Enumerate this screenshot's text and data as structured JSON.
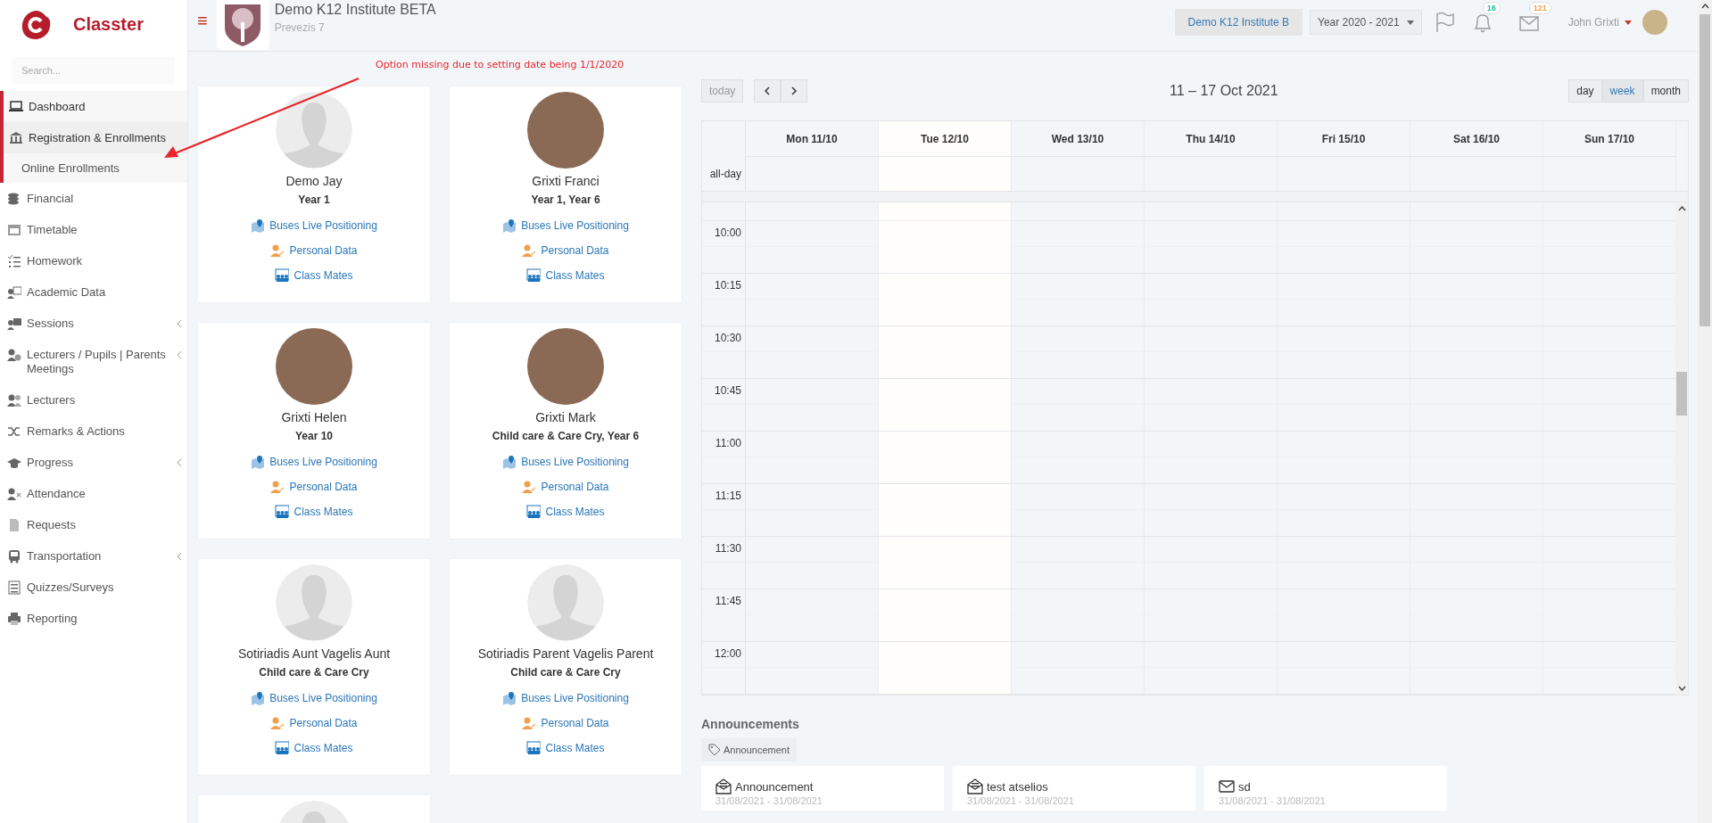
{
  "brand": {
    "name": "Classter"
  },
  "sidebar": {
    "search": {
      "placeholder": "Search..."
    },
    "items": [
      {
        "label": "Dashboard",
        "selected": true,
        "expanded": false,
        "has_submenu": false
      },
      {
        "label": "Registration & Enrollments",
        "selected": false,
        "expanded": true,
        "has_submenu": false,
        "children": [
          {
            "label": "Online Enrollments",
            "selected": false
          }
        ]
      },
      {
        "label": "Financial",
        "selected": false,
        "expanded": false,
        "has_submenu": false
      },
      {
        "label": "Timetable",
        "selected": false,
        "expanded": false,
        "has_submenu": false
      },
      {
        "label": "Homework",
        "selected": false,
        "expanded": false,
        "has_submenu": false
      },
      {
        "label": "Academic Data",
        "selected": false,
        "expanded": false,
        "has_submenu": false
      },
      {
        "label": "Sessions",
        "selected": false,
        "expanded": false,
        "has_submenu": true
      },
      {
        "label": "Lecturers / Pupils | Parents Meetings",
        "selected": false,
        "expanded": false,
        "has_submenu": true
      },
      {
        "label": "Lecturers",
        "selected": false,
        "expanded": false,
        "has_submenu": false
      },
      {
        "label": "Remarks & Actions",
        "selected": false,
        "expanded": false,
        "has_submenu": false
      },
      {
        "label": "Progress",
        "selected": false,
        "expanded": false,
        "has_submenu": true
      },
      {
        "label": "Attendance",
        "selected": false,
        "expanded": false,
        "has_submenu": false
      },
      {
        "label": "Requests",
        "selected": false,
        "expanded": false,
        "has_submenu": false
      },
      {
        "label": "Transportation",
        "selected": false,
        "expanded": false,
        "has_submenu": true
      },
      {
        "label": "Quizzes/Surveys",
        "selected": false,
        "expanded": false,
        "has_submenu": false
      },
      {
        "label": "Reporting",
        "selected": false,
        "expanded": false,
        "has_submenu": false
      }
    ]
  },
  "header": {
    "menu_glyph": "≡",
    "institute": "Demo K12 Institute BETA",
    "address": "Prevezis 7",
    "institute_button": "Demo K12 Institute B",
    "year_select": "Year 2020 - 2021",
    "badges": [
      {
        "count": "16",
        "color": "#1abc9c"
      },
      {
        "count": "121",
        "color": "#f0a04b"
      }
    ],
    "user": "John Grixti"
  },
  "annotation": {
    "text": "Option missing due to setting date being  1/1/2020"
  },
  "cards": [
    {
      "kind": "silhouette",
      "name": "Demo Jay",
      "classes": "Year 1",
      "links": [
        "Buses Live Positioning",
        "Personal Data",
        "Class Mates"
      ]
    },
    {
      "kind": "photo",
      "name": "Grixti Franci",
      "classes": "Year 1, Year 6",
      "links": [
        "Buses Live Positioning",
        "Personal Data",
        "Class Mates"
      ]
    },
    {
      "kind": "photo",
      "name": "Grixti Helen",
      "classes": "Year 10",
      "links": [
        "Buses Live Positioning",
        "Personal Data",
        "Class Mates"
      ]
    },
    {
      "kind": "photo",
      "name": "Grixti Mark",
      "classes": "Child care & Care Cry, Year 6",
      "links": [
        "Buses Live Positioning",
        "Personal Data",
        "Class Mates"
      ]
    },
    {
      "kind": "silhouette",
      "name": "Sotiriadis Aunt Vagelis Aunt",
      "classes": "Child care & Care Cry",
      "links": [
        "Buses Live Positioning",
        "Personal Data",
        "Class Mates"
      ]
    },
    {
      "kind": "silhouette",
      "name": "Sotiriadis Parent Vagelis Parent",
      "classes": "Child care & Care Cry",
      "links": [
        "Buses Live Positioning",
        "Personal Data",
        "Class Mates"
      ]
    },
    {
      "kind": "silhouette"
    }
  ],
  "calendar": {
    "today_button": "today",
    "title": "11 – 17 Oct 2021",
    "views": [
      {
        "label": "day",
        "selected": false
      },
      {
        "label": "week",
        "selected": true
      },
      {
        "label": "month",
        "selected": false
      }
    ],
    "days": [
      {
        "label": "Mon 11/10",
        "today": false
      },
      {
        "label": "Tue 12/10",
        "today": true
      },
      {
        "label": "Wed 13/10",
        "today": false
      },
      {
        "label": "Thu 14/10",
        "today": false
      },
      {
        "label": "Fri 15/10",
        "today": false
      },
      {
        "label": "Sat 16/10",
        "today": false
      },
      {
        "label": "Sun 17/10",
        "today": false
      }
    ],
    "allday_label": "all-day",
    "times": [
      "10:00",
      "10:15",
      "10:30",
      "10:45",
      "11:00",
      "11:15",
      "11:30",
      "11:45",
      "12:00"
    ]
  },
  "announcements": {
    "title": "Announcements",
    "tag": "Announcement",
    "items": [
      {
        "kind": "open",
        "title": "Announcement",
        "dates": "31/08/2021 - 31/08/2021"
      },
      {
        "kind": "open",
        "title": "test atselios",
        "dates": "31/08/2021 - 31/08/2021"
      },
      {
        "kind": "closed",
        "title": "sd",
        "dates": "31/08/2021 - 31/08/2021"
      }
    ]
  }
}
